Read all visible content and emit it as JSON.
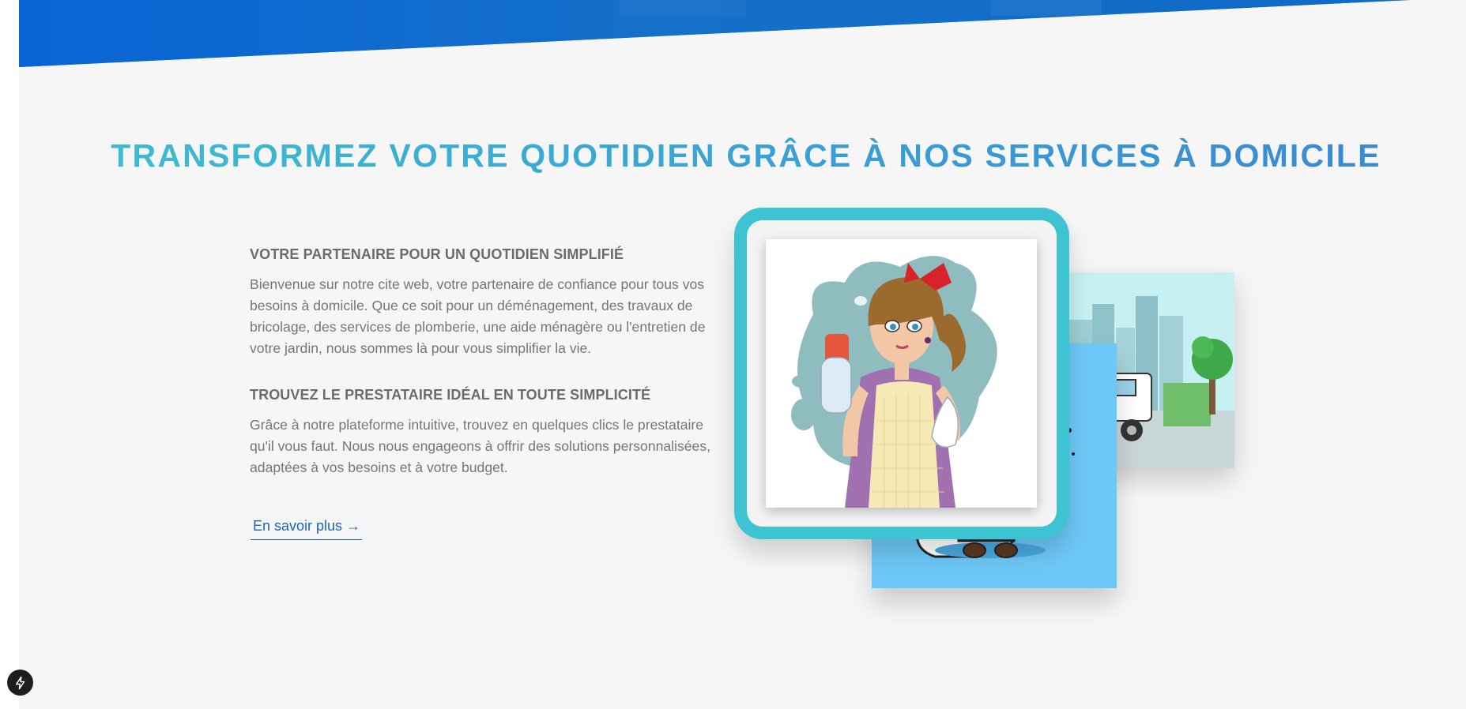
{
  "headline": "TRANSFORMEZ VOTRE QUOTIDIEN GRÂCE À NOS SERVICES À DOMICILE",
  "sections": [
    {
      "title": "VOTRE PARTENAIRE POUR UN QUOTIDIEN SIMPLIFIÉ",
      "text": "Bienvenue sur notre cite web, votre partenaire de confiance pour tous vos besoins à domicile. Que ce soit pour un déménagement, des travaux de bricolage, des services de plomberie, une aide ménagère ou l'entretien de votre jardin, nous sommes là pour vous simplifier la vie."
    },
    {
      "title": "TROUVEZ LE PRESTATAIRE IDÉAL EN TOUTE SIMPLICITÉ",
      "text": "Grâce à notre plateforme intuitive, trouvez en quelques clics le prestataire qu'il vous faut. Nous nous engageons à offrir des solutions personnalisées, adaptées à vos besoins et à votre budget."
    }
  ],
  "cta": {
    "label": "En savoir plus →"
  },
  "icons": {
    "floating_button": "lightning-bolt-icon"
  },
  "colors": {
    "hero_blue": "#0f6fd0",
    "headline_start": "#3ec0cf",
    "headline_end": "#3a86d0",
    "frame_teal": "#3ec3d2",
    "link_blue": "#1a63c2",
    "page_bg": "#f6f6f6"
  }
}
